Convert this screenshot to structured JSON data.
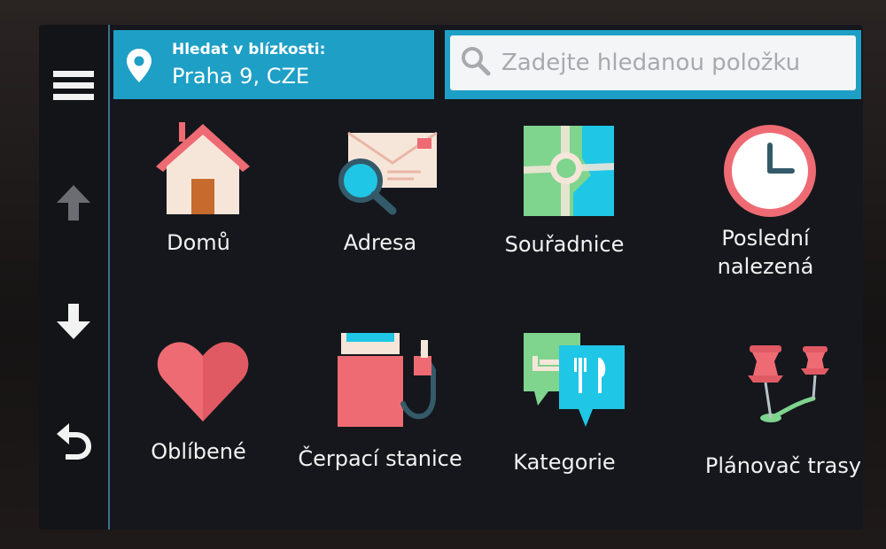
{
  "search_near": {
    "label": "Hledat v blízkosti:",
    "value": "Praha 9, CZE"
  },
  "search": {
    "placeholder": "Zadejte hledanou položku"
  },
  "sidebar": {
    "menu_icon": "menu-icon",
    "up_icon": "arrow-up-icon",
    "down_icon": "arrow-down-icon",
    "back_icon": "back-icon"
  },
  "categories": [
    {
      "label": "Domů",
      "icon": "home-icon"
    },
    {
      "label": "Adresa",
      "icon": "address-icon"
    },
    {
      "label": "Souřadnice",
      "icon": "coordinates-icon"
    },
    {
      "label": "Poslední nalezená",
      "icon": "clock-icon"
    },
    {
      "label": "Oblíbené",
      "icon": "heart-icon"
    },
    {
      "label": "Čerpací stanice",
      "icon": "fuel-pump-icon"
    },
    {
      "label": "Kategorie",
      "icon": "categories-icon"
    },
    {
      "label": "Plánovač trasy",
      "icon": "route-planner-icon"
    }
  ],
  "colors": {
    "accent": "#1e9fc6",
    "tile_red": "#ee6b73"
  }
}
